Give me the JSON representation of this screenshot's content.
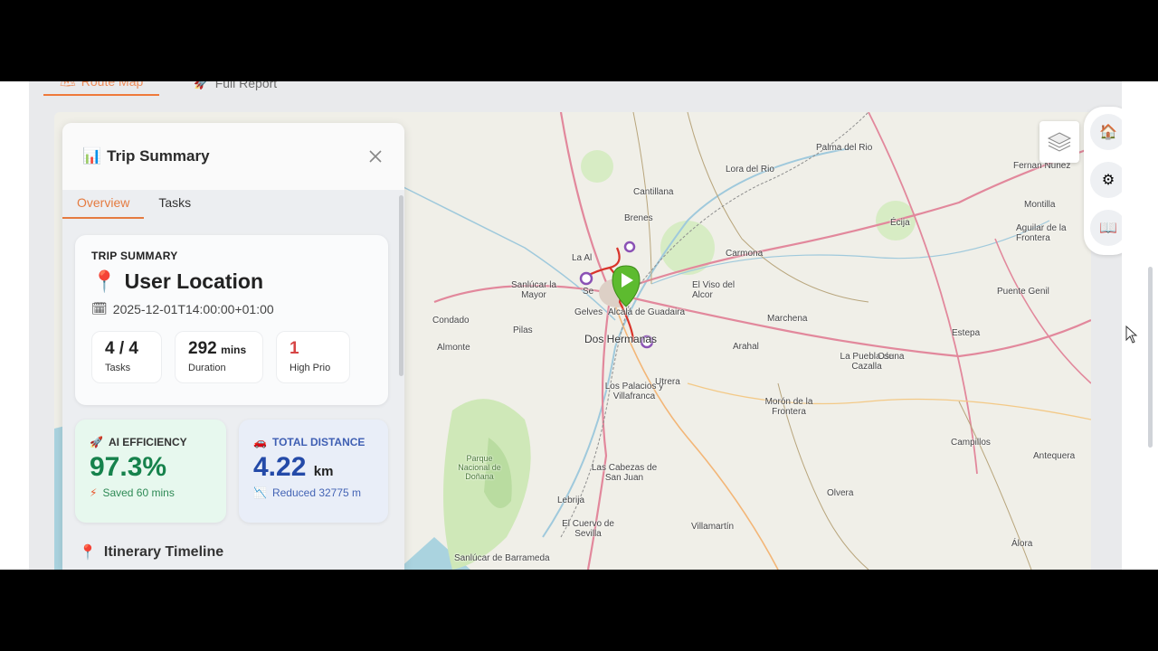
{
  "top_tabs": [
    {
      "label": "Route Map",
      "icon": "map-icon",
      "active": true
    },
    {
      "label": "Full Report",
      "icon": "rocket-icon",
      "active": false
    }
  ],
  "panel": {
    "title": "Trip Summary",
    "tabs": [
      {
        "label": "Overview",
        "active": true
      },
      {
        "label": "Tasks",
        "active": false
      }
    ],
    "summary": {
      "eyebrow": "TRIP SUMMARY",
      "location": "User Location",
      "datetime": "2025-12-01T14:00:00+01:00",
      "stats": [
        {
          "value": "4 / 4",
          "unit": "",
          "label": "Tasks"
        },
        {
          "value": "292",
          "unit": "mins",
          "label": "Duration"
        },
        {
          "value": "1",
          "unit": "",
          "label": "High Prio"
        }
      ]
    },
    "ai_efficiency": {
      "label": "AI EFFICIENCY",
      "value": "97.3%",
      "sub": "Saved 60 mins"
    },
    "total_distance": {
      "label": "TOTAL DISTANCE",
      "value": "4.22",
      "unit": "km",
      "sub": "Reduced 32775 m"
    },
    "itinerary_title": "Itinerary Timeline"
  },
  "map_labels": [
    "Palma del Rio",
    "Lora del Rio",
    "Fernan Núñez",
    "Montilla",
    "Cantillana",
    "Brenes",
    "Écija",
    "Aguilar de la Frontera",
    "Carmona",
    "Sanlúcar la Mayor",
    "El Viso del Alcor",
    "Puente Genil",
    "Condado",
    "Pilas",
    "Gelves",
    "Alcalá de Guadaira",
    "Marchena",
    "Almonte",
    "Dos Hermanas",
    "Arahal",
    "La Puebla de Cazalla",
    "Osuna",
    "Estepa",
    "Los Palacios y Villafranca",
    "Utrera",
    "Morón de la Frontera",
    "Campillos",
    "Antequera",
    "Parque Nacional de Doñana",
    "Las Cabezas de San Juan",
    "Lebrija",
    "Olvera",
    "El Cuervo de Sevilla",
    "Villamartín",
    "Álora",
    "Sanlúcar de Barrameda",
    "La Al",
    "Se"
  ],
  "controls": {
    "layers": "layers-icon",
    "side": [
      "home-icon",
      "settings-icon",
      "book-icon"
    ]
  }
}
